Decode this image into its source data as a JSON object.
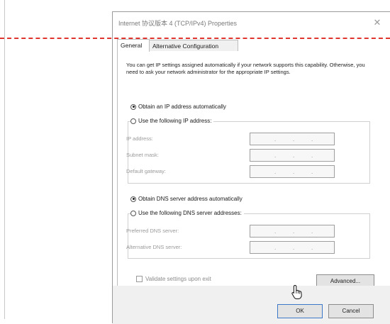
{
  "window": {
    "title": "Internet 协议版本 4 (TCP/IPv4) Properties",
    "close_glyph": "✕"
  },
  "tabs": [
    {
      "label": "General",
      "active": true
    },
    {
      "label": "Alternative Configuration",
      "active": false
    }
  ],
  "description": "You can get IP settings assigned automatically if your network supports this capability. Otherwise, you need to ask your network administrator for the appropriate IP settings.",
  "ip_section": {
    "auto_label": "Obtain an IP address automatically",
    "auto_checked": true,
    "manual_label": "Use the following IP address:",
    "fields": [
      {
        "label": "IP address:",
        "value": ".   .   ."
      },
      {
        "label": "Subnet mask:",
        "value": ".   .   ."
      },
      {
        "label": "Default gateway:",
        "value": ".   .   ."
      }
    ]
  },
  "dns_section": {
    "auto_label": "Obtain DNS server address automatically",
    "auto_checked": true,
    "manual_label": "Use the following DNS server addresses:",
    "fields": [
      {
        "label": "Preferred DNS server:",
        "value": ".   .   ."
      },
      {
        "label": "Alternative DNS server:",
        "value": ".   .   ."
      }
    ]
  },
  "validate_label": "Validate settings upon exit",
  "buttons": {
    "advanced": "Advanced...",
    "ok": "OK",
    "cancel": "Cancel"
  },
  "colors": {
    "dashed_line": "#e0352e",
    "ok_border": "#3b78c8"
  }
}
